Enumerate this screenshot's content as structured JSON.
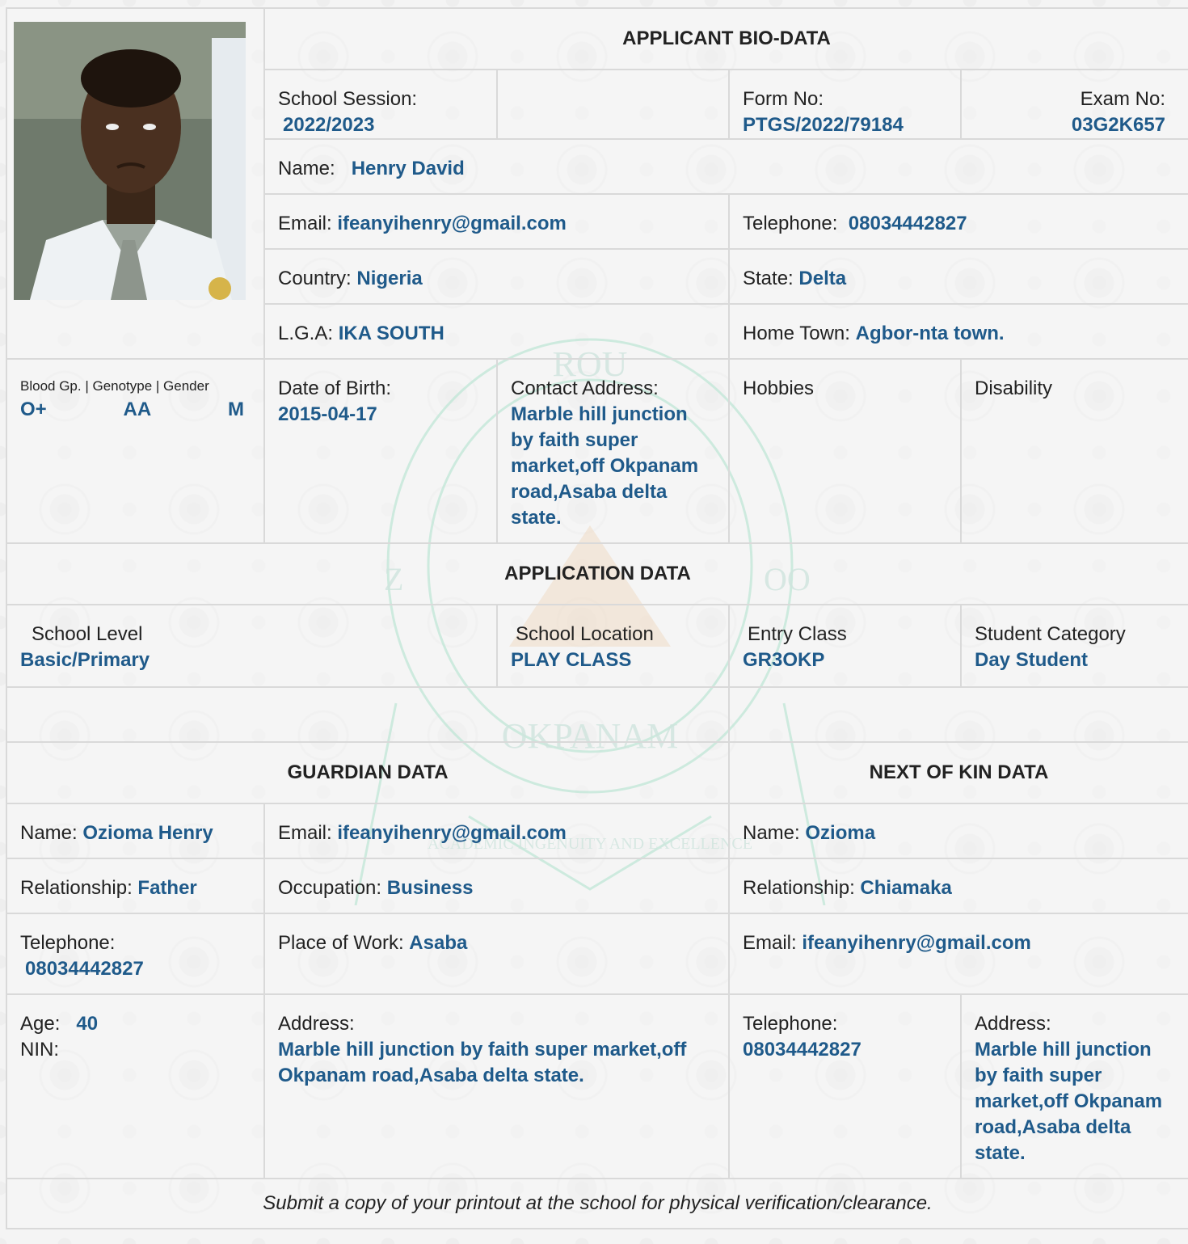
{
  "bio": {
    "heading": "APPLICANT BIO-DATA",
    "session_label": "School Session:",
    "session_value": "2022/2023",
    "form_label": "Form No:",
    "form_value": "PTGS/2022/79184",
    "exam_label": "Exam No:",
    "exam_value": "03G2K657",
    "name_label": "Name:",
    "name_value": "Henry David",
    "email_label": "Email:",
    "email_value": "ifeanyihenry@gmail.com",
    "tel_label": "Telephone:",
    "tel_value": "08034442827",
    "country_label": "Country:",
    "country_value": "Nigeria",
    "state_label": "State:",
    "state_value": "Delta",
    "lga_label": "L.G.A:",
    "lga_value": "IKA SOUTH",
    "hometown_label": "Home Town:",
    "hometown_value": "Agbor-nta town.",
    "bgg_label": "Blood Gp. | Genotype | Gender",
    "blood_value": "O+",
    "genotype_value": "AA",
    "gender_value": "M",
    "dob_label": "Date of Birth:",
    "dob_value": "2015-04-17",
    "contact_label": "Contact Address:",
    "contact_value": "Marble hill junction by faith super market,off Okpanam road,Asaba delta state.",
    "hobbies_label": "Hobbies",
    "disability_label": "Disability"
  },
  "application": {
    "heading": "APPLICATION DATA",
    "level_label": "School Level",
    "level_value": "Basic/Primary",
    "location_label": "School Location",
    "location_value": "PLAY CLASS",
    "entry_label": "Entry Class",
    "entry_value": "GR3OKP",
    "category_label": "Student Category",
    "category_value": "Day Student"
  },
  "guardian": {
    "heading": "GUARDIAN DATA",
    "name_label": "Name:",
    "name_value": "Ozioma Henry",
    "email_label": "Email:",
    "email_value": "ifeanyihenry@gmail.com",
    "rel_label": "Relationship:",
    "rel_value": "Father",
    "occ_label": "Occupation:",
    "occ_value": "Business",
    "tel_label": "Telephone:",
    "tel_value": "08034442827",
    "pow_label": "Place of Work:",
    "pow_value": "Asaba",
    "age_label": "Age:",
    "age_value": "40",
    "nin_label": "NIN:",
    "addr_label": "Address:",
    "addr_value": "Marble hill junction by faith super market,off Okpanam road,Asaba delta state."
  },
  "kin": {
    "heading": "NEXT OF KIN DATA",
    "name_label": "Name:",
    "name_value": "Ozioma",
    "rel_label": "Relationship:",
    "rel_value": "Chiamaka",
    "email_label": "Email:",
    "email_value": "ifeanyihenry@gmail.com",
    "tel_label": "Telephone:",
    "tel_value": "08034442827",
    "addr_label": "Address:",
    "addr_value": "Marble hill junction by faith super market,off Okpanam road,Asaba delta state."
  },
  "watermark": {
    "top_text": "ROU",
    "left_text": "Z",
    "right_text": "OO",
    "mid_text": "OKPANAM",
    "motto": "ACADEMIC INGENUITY AND EXCELLENCE"
  },
  "footer": {
    "note": "Submit a copy of your printout at the school for physical verification/clearance."
  }
}
